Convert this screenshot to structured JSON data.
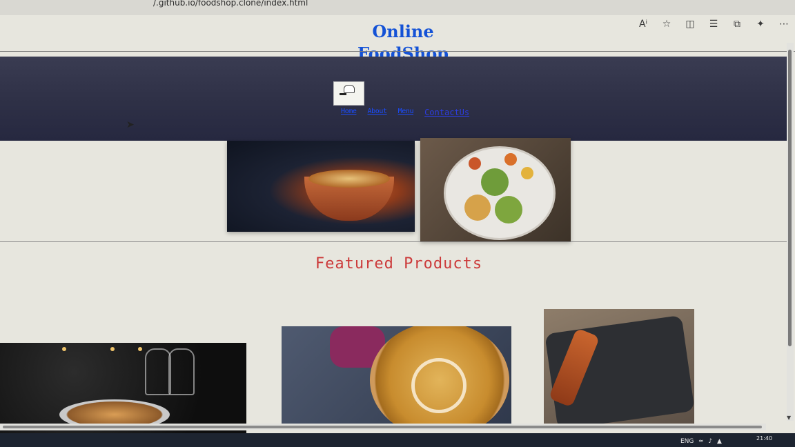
{
  "browser": {
    "url": "/.github.io/foodshop.clone/index.html",
    "icons": [
      "read-aloud-icon",
      "favorite-star-icon",
      "split-screen-icon",
      "favorites-list-icon",
      "collections-icon",
      "extensions-icon",
      "more-icon"
    ]
  },
  "header": {
    "title_line1": "Online",
    "title_line2": "FoodShop"
  },
  "nav": {
    "items": [
      "Home",
      "About",
      "Menu",
      "ContactUs"
    ]
  },
  "sections": {
    "featured_title": "Featured Products"
  },
  "taskbar": {
    "language": "ENG",
    "time": "21:40"
  },
  "colors": {
    "title": "#1452d6",
    "navbar": "#2f3147",
    "featured": "#cc3a3a",
    "link": "#1a4cff"
  }
}
